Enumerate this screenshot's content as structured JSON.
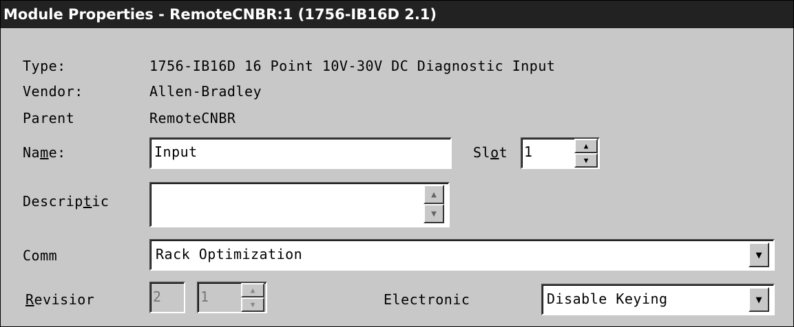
{
  "window": {
    "title": "Module Properties  - RemoteCNBR:1 (1756-IB16D 2.1)"
  },
  "info": {
    "type_label": "Type:",
    "type_value": "1756-IB16D 16 Point 10V-30V DC Diagnostic Input",
    "vendor_label": "Vendor:",
    "vendor_value": "Allen-Bradley",
    "parent_label": "Parent",
    "parent_value": "RemoteCNBR"
  },
  "name": {
    "label_pre": "Na",
    "label_ul": "m",
    "label_post": "e:",
    "value": "Input"
  },
  "slot": {
    "label_pre": "Sl",
    "label_ul": "o",
    "label_post": "t",
    "value": "1"
  },
  "description": {
    "label_pre": "Descrip",
    "label_ul": "t",
    "label_post": "ic",
    "value": ""
  },
  "comm": {
    "label": "Comm",
    "selected": "Rack Optimization"
  },
  "revision": {
    "label_ul": "R",
    "label_post": "evisior",
    "major": "2",
    "minor": "1"
  },
  "electronic": {
    "label": "Electronic",
    "selected": "Disable Keying"
  },
  "icons": {
    "spin_up": "▲",
    "spin_down": "▼",
    "dropdown": "▼"
  }
}
